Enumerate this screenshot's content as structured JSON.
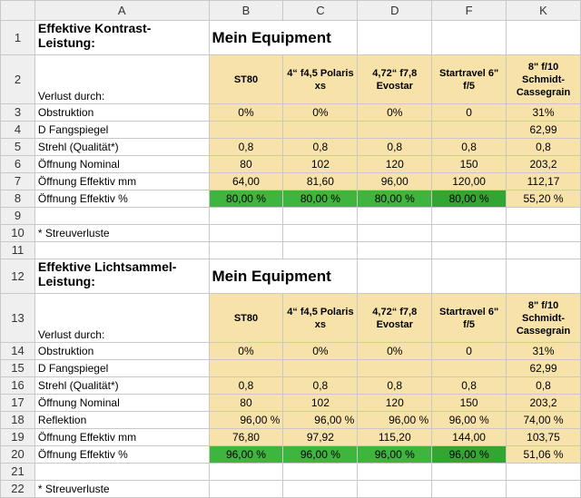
{
  "columns": [
    "A",
    "B",
    "C",
    "D",
    "F",
    "K"
  ],
  "section1": {
    "title": "Effektive Kontrast-Leistung:",
    "equipment_label": "Mein Equipment",
    "verlust_label": "Verlust durch:",
    "col_headers": [
      "ST80",
      "4“ f4,5 Polaris xs",
      "4,72“ f7,8 Evostar",
      "Startravel 6\" f/5",
      "8\" f/10 Schmidt-Cassegrain"
    ],
    "rows": [
      {
        "num": "3",
        "label": "Obstruktion",
        "values": [
          "0%",
          "0%",
          "0%",
          "0",
          "31%"
        ]
      },
      {
        "num": "4",
        "label": "D Fangspiegel",
        "values": [
          "",
          "",
          "",
          "",
          "62,99"
        ]
      },
      {
        "num": "5",
        "label": "Strehl (Qualität*)",
        "values": [
          "0,8",
          "0,8",
          "0,8",
          "0,8",
          "0,8"
        ]
      },
      {
        "num": "6",
        "label": "Öffnung Nominal",
        "values": [
          "80",
          "102",
          "120",
          "150",
          "203,2"
        ]
      },
      {
        "num": "7",
        "label": "Öffnung Effektiv mm",
        "values": [
          "64,00",
          "81,60",
          "96,00",
          "120,00",
          "112,17"
        ]
      },
      {
        "num": "8",
        "label": "Öffnung Effektiv %",
        "values": [
          "80,00 %",
          "80,00 %",
          "80,00 %",
          "80,00 %",
          "55,20 %"
        ]
      }
    ],
    "footnote": "* Streuverluste"
  },
  "section2": {
    "title": "Effektive Lichtsammel-Leistung:",
    "equipment_label": "Mein Equipment",
    "verlust_label": "Verlust durch:",
    "col_headers": [
      "ST80",
      "4“ f4,5 Polaris xs",
      "4,72“ f7,8 Evostar",
      "Startravel 6\" f/5",
      "8\" f/10 Schmidt-Cassegrain"
    ],
    "rows": [
      {
        "num": "14",
        "label": "Obstruktion",
        "values": [
          "0%",
          "0%",
          "0%",
          "0",
          "31%"
        ]
      },
      {
        "num": "15",
        "label": "D Fangspiegel",
        "values": [
          "",
          "",
          "",
          "",
          "62,99"
        ]
      },
      {
        "num": "16",
        "label": "Strehl (Qualität*)",
        "values": [
          "0,8",
          "0,8",
          "0,8",
          "0,8",
          "0,8"
        ]
      },
      {
        "num": "17",
        "label": "Öffnung Nominal",
        "values": [
          "80",
          "102",
          "120",
          "150",
          "203,2"
        ]
      },
      {
        "num": "18",
        "label": "Reflektion",
        "values": [
          "96,00 %",
          "96,00 %",
          "96,00 %",
          "96,00 %",
          "74,00 %"
        ]
      },
      {
        "num": "19",
        "label": "Öffnung Effektiv mm",
        "values": [
          "76,80",
          "97,92",
          "115,20",
          "144,00",
          "103,75"
        ]
      },
      {
        "num": "20",
        "label": "Öffnung Effektiv %",
        "values": [
          "96,00 %",
          "96,00 %",
          "96,00 %",
          "96,00 %",
          "51,06 %"
        ]
      }
    ],
    "footnote": "* Streuverluste"
  },
  "row_numbers": [
    "1",
    "2",
    "9",
    "10",
    "11",
    "12",
    "13",
    "21",
    "22"
  ]
}
